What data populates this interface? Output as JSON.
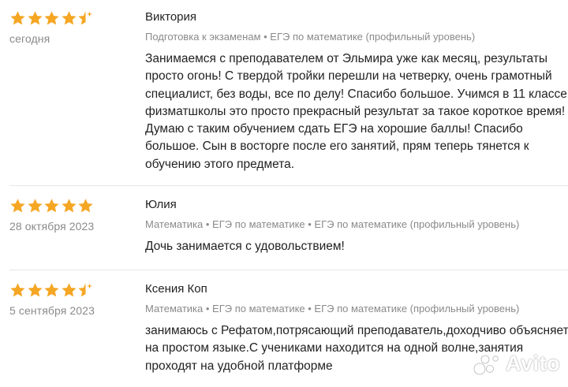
{
  "colors": {
    "star": "#f5a623",
    "text": "#222222",
    "muted": "#8a8a8a",
    "divider": "#e6e6e6"
  },
  "reviews": [
    {
      "author": "Виктория",
      "date": "сегодня",
      "rating": 4.5,
      "tags": "Подготовка к экзаменам • ЕГЭ по математике (профильный уровень)",
      "text": "Занимаемся с преподавателем от Эльмира уже как месяц, результаты просто огонь! С твердой тройки перешли на четверку, очень грамотный специалист, без воды, все по делу! Спасибо большое. Учимся в 11 классе физматшколы это просто прекрасный результат за такое короткое время! Думаю с таким обучением сдать ЕГЭ на хорошие баллы! Спасибо большое. Сын в восторге после его занятий, прям теперь тянется к обучению этого предмета."
    },
    {
      "author": "Юлия",
      "date": "28 октября 2023",
      "rating": 5,
      "tags": "Математика • ЕГЭ по математике • ЕГЭ по математике (профильный уровень)",
      "text": "Дочь занимается с удовольствием!"
    },
    {
      "author": "Ксения Коп",
      "date": "5 сентября 2023",
      "rating": 4.5,
      "tags": "Математика • ЕГЭ по математике • ЕГЭ по математике (профильный уровень)",
      "text": "занимаюсь с Рефатом,потрясающий преподаватель,доходчиво объясняет на простом языке.С учениками находится на одной волне,занятия проходят на удобной платформе"
    }
  ],
  "watermark": {
    "text": "Avito",
    "icon": "avito-logo-icon"
  }
}
